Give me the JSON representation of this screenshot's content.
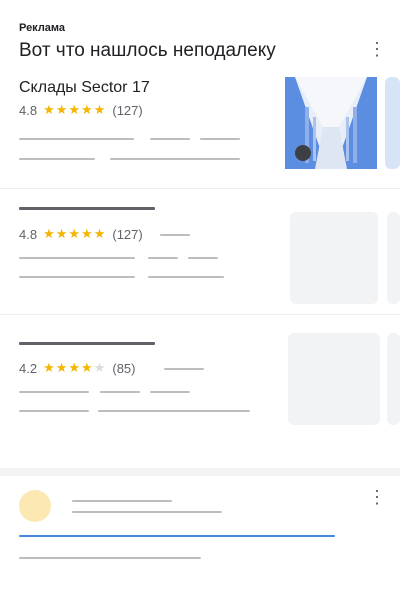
{
  "header": {
    "ad_label": "Реклама",
    "title": "Вот что нашлось неподалеку"
  },
  "results": [
    {
      "name": "Склады Sector 17",
      "rating": "4.8",
      "stars": 5,
      "reviews": "(127)"
    },
    {
      "name": "",
      "rating": "4.8",
      "stars": 5,
      "reviews": "(127)"
    },
    {
      "name": "",
      "rating": "4.2",
      "stars": 4,
      "reviews": "(85)"
    }
  ],
  "icons": {
    "menu": "more-vert-icon",
    "star": "star-icon"
  },
  "colors": {
    "star": "#f4b400",
    "accent_blue": "#4a86d8",
    "avatar": "#fce8b2"
  }
}
